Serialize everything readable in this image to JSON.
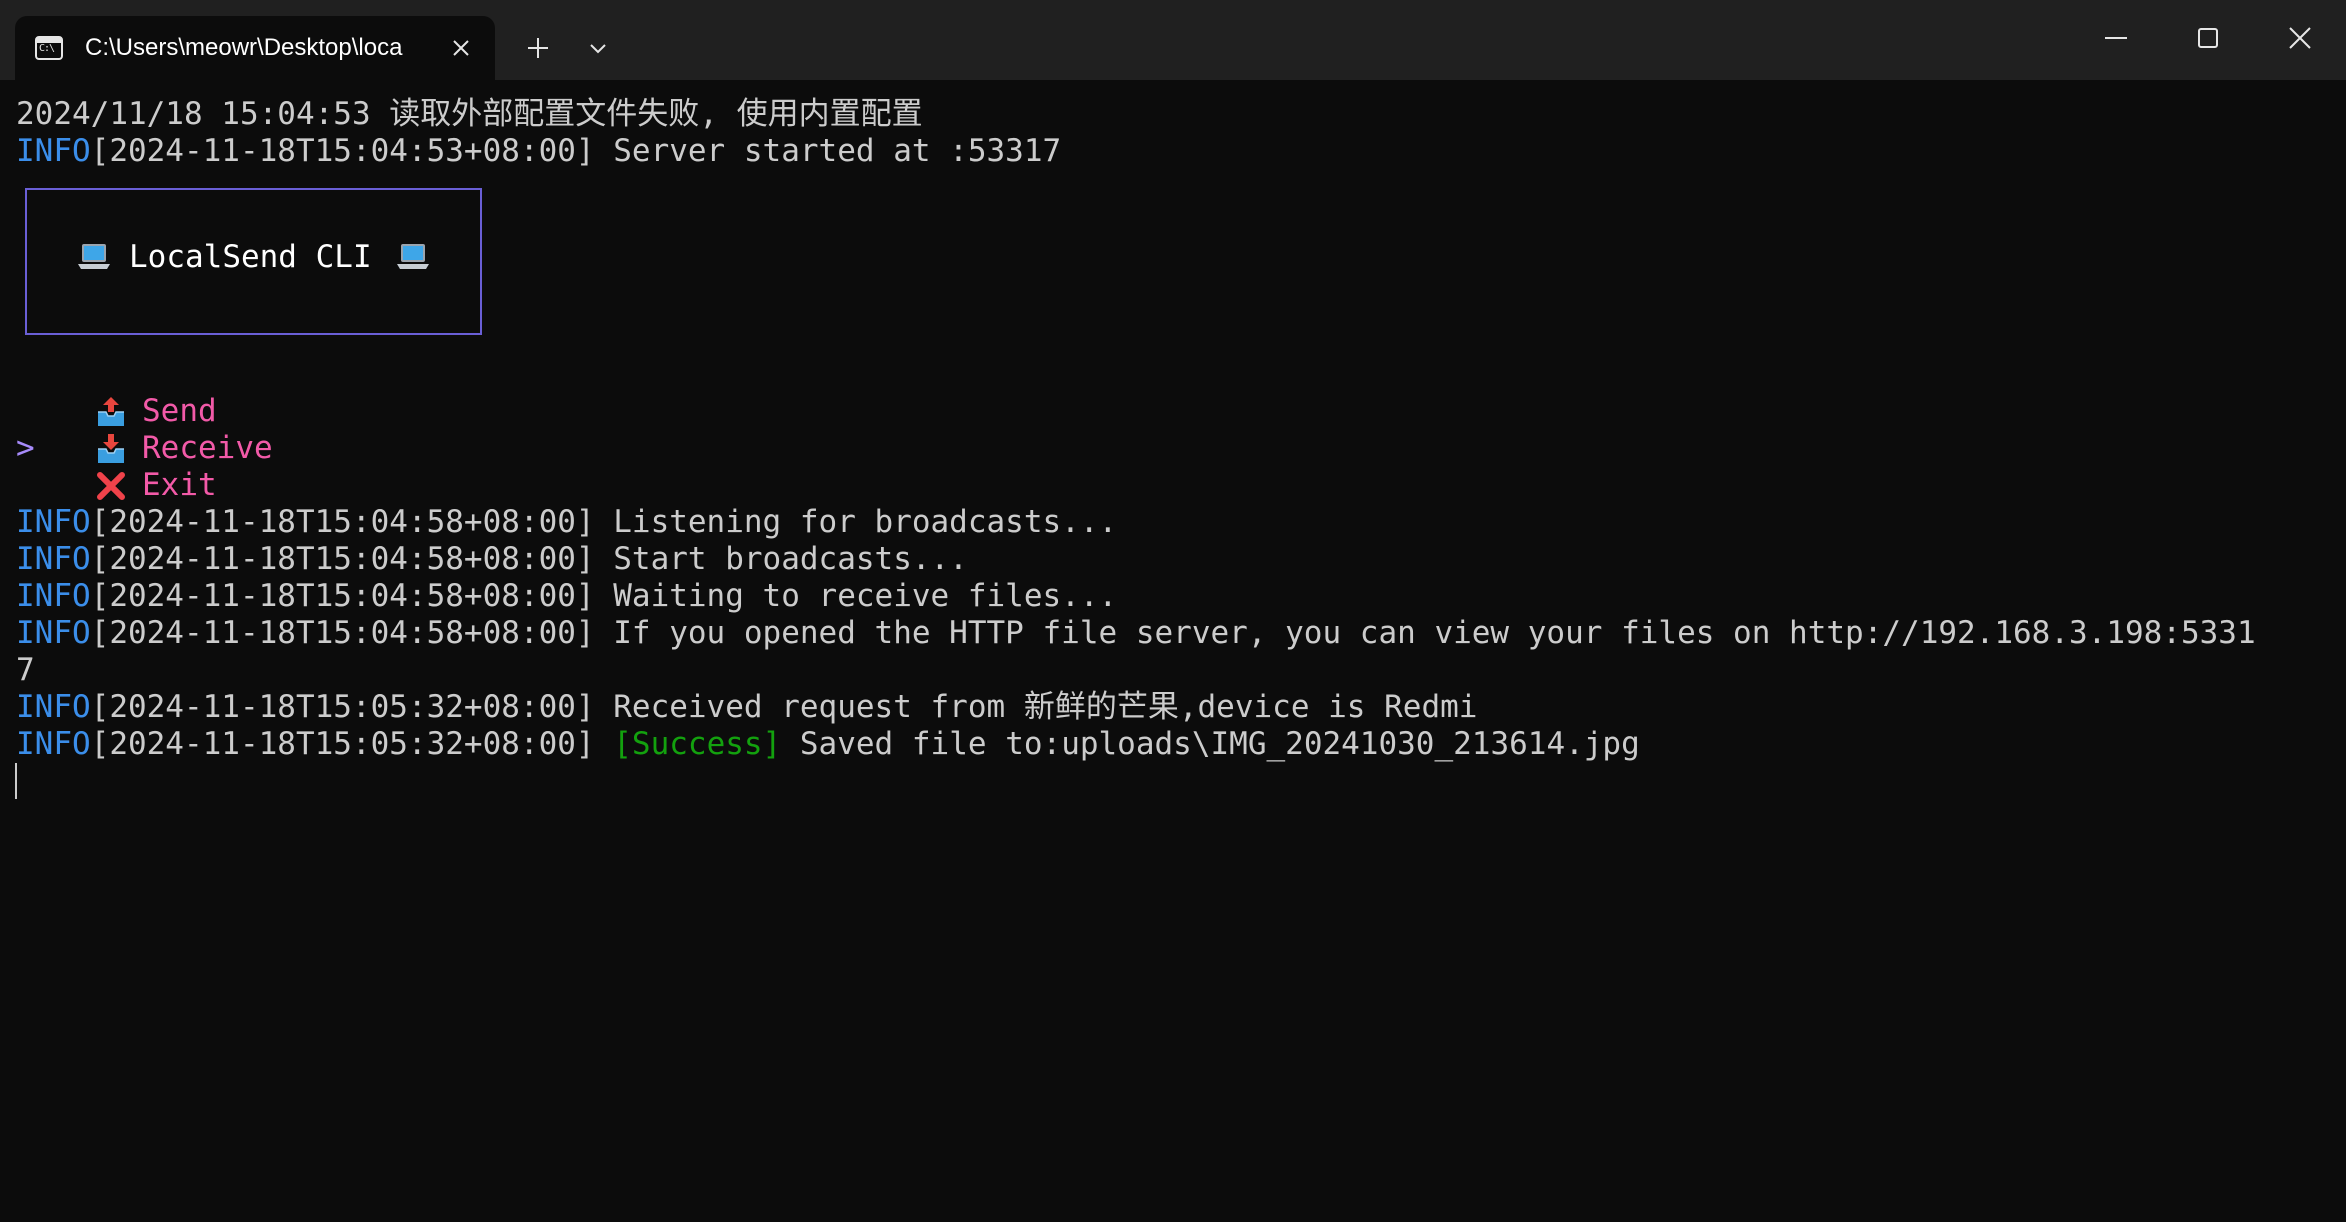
{
  "tab": {
    "title": "C:\\Users\\meowr\\Desktop\\loca",
    "icon_text": "C:\\",
    "icon": "terminal-icon"
  },
  "titlebar": {
    "new_tab_icon": "plus-icon",
    "dropdown_icon": "chevron-down-icon",
    "minimize_icon": "minimize-icon",
    "maximize_icon": "maximize-icon",
    "close_icon": "close-icon"
  },
  "colors": {
    "background": "#0c0c0c",
    "titlebar": "#202020",
    "text": "#cccccc",
    "info": "#3b8eea",
    "success": "#13a10e",
    "menu": "#f25aa8",
    "pointer": "#a78bfa",
    "banner_border": "#6a5fd6"
  },
  "terminal": {
    "line1": "2024/11/18 15:04:53 读取外部配置文件失败, 使用内置配置",
    "line2": {
      "level": "INFO",
      "ts": "[2024-11-18T15:04:53+08:00]",
      "msg": " Server started at :53317"
    },
    "banner": {
      "text": "LocalSend CLI",
      "icon": "laptop-icon"
    },
    "menu": {
      "pointer": ">",
      "items": [
        {
          "label": "Send",
          "icon": "outbox-tray-icon"
        },
        {
          "label": "Receive",
          "icon": "inbox-tray-icon"
        },
        {
          "label": "Exit",
          "icon": "cross-mark-icon"
        }
      ]
    },
    "logs": [
      {
        "level": "INFO",
        "ts": "[2024-11-18T15:04:58+08:00]",
        "msg": " Listening for broadcasts..."
      },
      {
        "level": "INFO",
        "ts": "[2024-11-18T15:04:58+08:00]",
        "msg": " Start broadcasts..."
      },
      {
        "level": "INFO",
        "ts": "[2024-11-18T15:04:58+08:00]",
        "msg": " Waiting to receive files..."
      },
      {
        "level": "INFO",
        "ts": "[2024-11-18T15:04:58+08:00]",
        "msg": " If you opened the HTTP file server, you can view your files on http://192.168.3.198:5331"
      }
    ],
    "wrap": "7",
    "log5": {
      "level": "INFO",
      "ts": "[2024-11-18T15:05:32+08:00]",
      "msg": " Received request from 新鲜的芒果,device is Redmi"
    },
    "log6": {
      "level": "INFO",
      "ts": "[2024-11-18T15:05:32+08:00]",
      "tag": "[Success]",
      "msg": " Saved file to:uploads\\IMG_20241030_213614.jpg"
    }
  }
}
